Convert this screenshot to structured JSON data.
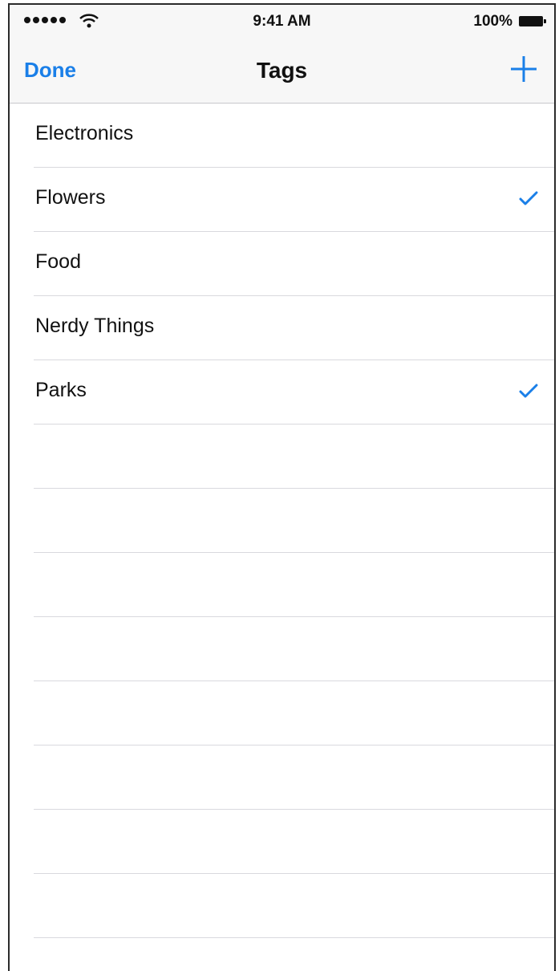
{
  "status_bar": {
    "time": "9:41 AM",
    "battery_percent": "100%",
    "signal_icon": "signal-dots-icon",
    "wifi_icon": "wifi-icon",
    "battery_icon": "battery-icon"
  },
  "nav": {
    "done_label": "Done",
    "title": "Tags",
    "add_icon": "plus-icon"
  },
  "tags": [
    {
      "label": "Electronics",
      "checked": false
    },
    {
      "label": "Flowers",
      "checked": true
    },
    {
      "label": "Food",
      "checked": false
    },
    {
      "label": "Nerdy Things",
      "checked": false
    },
    {
      "label": "Parks",
      "checked": true
    }
  ],
  "colors": {
    "accent": "#1a7fe8",
    "chrome_bg": "#f7f7f7",
    "separator": "#d9d9de"
  }
}
